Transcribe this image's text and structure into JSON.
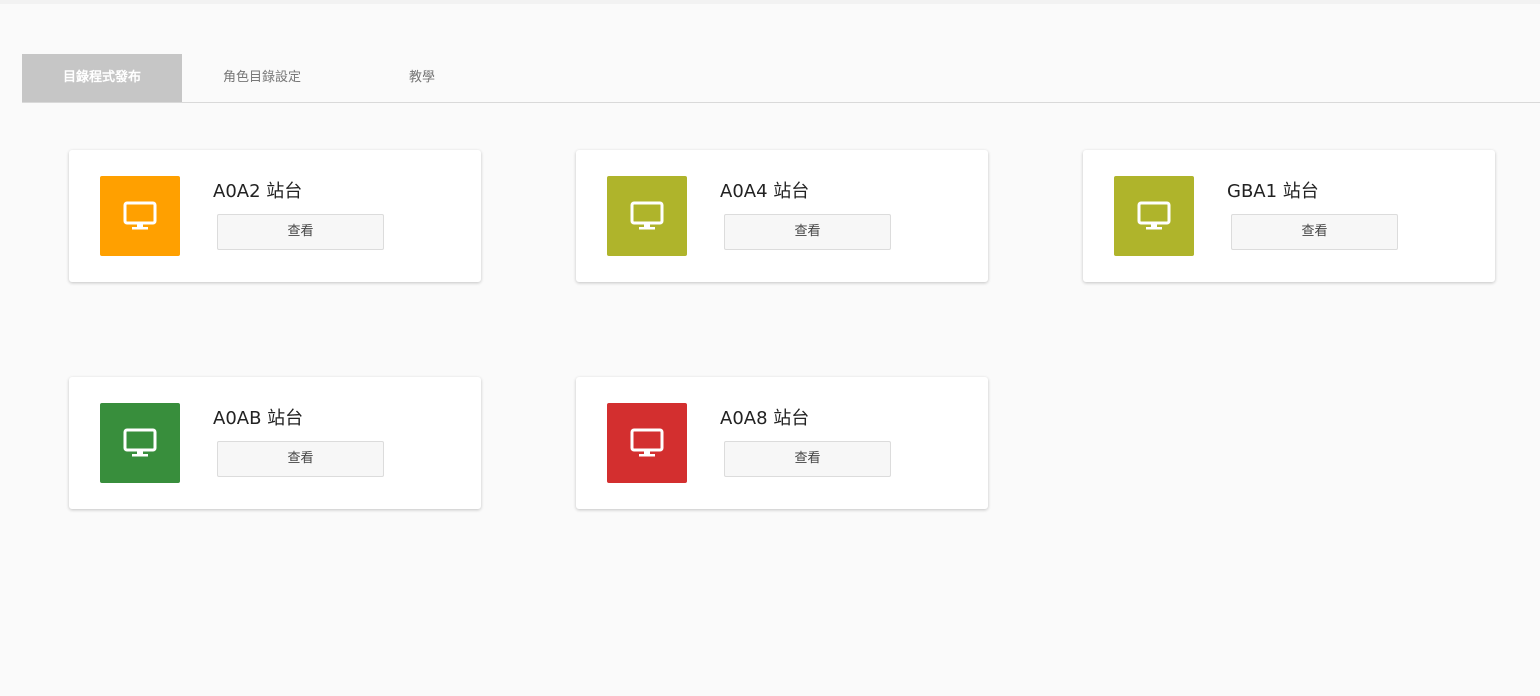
{
  "tabs": [
    {
      "label": "目錄程式發布",
      "active": true
    },
    {
      "label": "角色目錄設定",
      "active": false
    },
    {
      "label": "教學",
      "active": false
    }
  ],
  "stations": [
    {
      "name": "A0A2 站台",
      "button": "查看",
      "color": "#ffa000",
      "icon": "monitor-icon"
    },
    {
      "name": "A0A4 站台",
      "button": "查看",
      "color": "#afb42b",
      "icon": "monitor-icon"
    },
    {
      "name": "GBA1 站台",
      "button": "查看",
      "color": "#afb42b",
      "icon": "monitor-icon"
    },
    {
      "name": "A0AB 站台",
      "button": "查看",
      "color": "#388e3c",
      "icon": "monitor-icon"
    },
    {
      "name": "A0A8 站台",
      "button": "查看",
      "color": "#d32f2f",
      "icon": "monitor-icon"
    }
  ]
}
